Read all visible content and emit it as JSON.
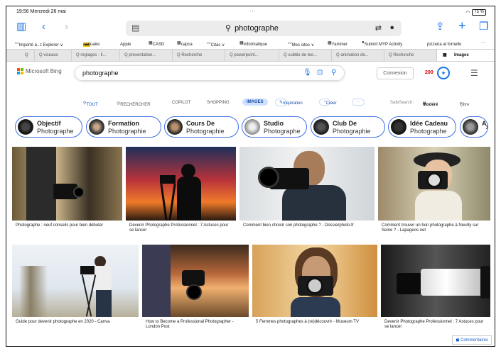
{
  "status": {
    "time": "19:56",
    "date": "Mercredi 26 mai",
    "battery": "75 %"
  },
  "toolbar": {
    "url": "photographe"
  },
  "bookmarks": [
    "Importé à...t Explorer ∨",
    "annuaire",
    "Apple",
    "CASD",
    "capca",
    "Citac ∨",
    "Informatique",
    "Mes sites ∨",
    "Yammer",
    "Submit MYP Activity",
    "pizzeria al fornello",
    "···"
  ],
  "tabs": [
    "Q",
    "Q  viseaux",
    "Q  reglages - ll...",
    "Q  presentation...",
    "Q  Recherche",
    "Q  powerpoint...",
    "Q  subtile de teo...",
    "Q  animation de...",
    "Q  Recherche",
    "Images"
  ],
  "bing": {
    "logo": "Microsoft Bing",
    "query": "photographe",
    "connexion": "Connexion",
    "points": "200"
  },
  "scopes": {
    "tout": "TOUT",
    "rechercher": "RECHERCHER",
    "copilot": "COPILOT",
    "shopping": "SHOPPING",
    "images": "IMAGES",
    "inspiration": "Inspiration",
    "creer": "Créer",
    "safesearch_label": "SafeSearch:",
    "safesearch_value": "Modéré",
    "filtre": "Filtre"
  },
  "chips": [
    {
      "t1": "Objectif",
      "t2": "Photographe"
    },
    {
      "t1": "Formation",
      "t2": "Photographie"
    },
    {
      "t1": "Cours De",
      "t2": "Photographie"
    },
    {
      "t1": "Studio",
      "t2": "Photographe"
    },
    {
      "t1": "Club De",
      "t2": "Photographie"
    },
    {
      "t1": "Idée Cadeau",
      "t2": "Photographe"
    },
    {
      "t1": "A",
      "t2": ""
    }
  ],
  "results": [
    {
      "cap": "Photographe : neuf conseils pour bien débuter"
    },
    {
      "cap": "Devenir Photographe Professionnel : 7 Astuces pour se lancer"
    },
    {
      "cap": "Comment bien choisir son photographe ? - Dossierphoto.fr"
    },
    {
      "cap": "Comment trouver un bon photographe à Neuilly sur Seine ? - Lapageos.net"
    },
    {
      "cap": "Guide pour devenir photographe en 2020 - Canva"
    },
    {
      "cap": "How to Become a Professional Photographer - London Post"
    },
    {
      "cap": "5 Femmes photographes à (re)découvrir - Museum TV"
    },
    {
      "cap": "Devenir Photographe Professionnel : 7 Astuces pour se lancer"
    }
  ],
  "feedback": "Commentaires"
}
